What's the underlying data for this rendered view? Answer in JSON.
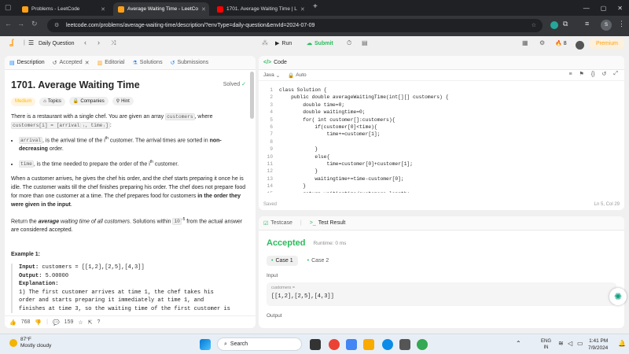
{
  "browser": {
    "tabs": [
      {
        "label": "Problems - LeetCode",
        "active": false
      },
      {
        "label": "Average Waiting Time - LeetCo",
        "active": true
      },
      {
        "label": "1701. Average Waiting Time | L",
        "active": false
      }
    ],
    "new_tab": "+",
    "url": "leetcode.com/problems/average-waiting-time/description/?envType=daily-question&envId=2024-07-09"
  },
  "header": {
    "daily_label": "Daily Question",
    "run_label": "Run",
    "submit_label": "Submit",
    "fire_count": "8",
    "premium_label": "Premium"
  },
  "left_tabs": [
    {
      "label": "Description"
    },
    {
      "label": "Accepted"
    },
    {
      "label": "Editorial"
    },
    {
      "label": "Solutions"
    },
    {
      "label": "Submissions"
    }
  ],
  "problem": {
    "title": "1701. Average Waiting Time",
    "solved": "Solved",
    "difficulty": "Medium",
    "topics": "Topics",
    "companies": "Companies",
    "hint": "Hint",
    "p1_a": "There is a restaurant with a single chef. You are given an array ",
    "p1_code": "customers",
    "p1_b": ", where",
    "p1_code2": "customers[i] = [arrival",
    "p1_c": " is the arrival time of the ",
    "b1_code": "arrival",
    "b1_a": ", is the arrival time of the ",
    "b1_i": "i",
    "b1_b": " customer. The arrival times are sorted in ",
    "b1_bold": "non-decreasing",
    "b1_c": " order.",
    "b2_code": "time",
    "b2_a": ", is the time needed to prepare the order of the ",
    "b2_b": " customer.",
    "p2": "When a customer arrives, he gives the chef his order, and the chef starts preparing it once he is idle. The customer waits till the chef finishes preparing his order. The chef does not prepare food for more than one customer at a time. The chef prepares food for customers ",
    "p2_bold": "in the order they were given in the input",
    "p3_a": "Return the ",
    "p3_i": "average",
    "p3_b": " waiting time of all customers",
    "p3_c": ". Solutions within ",
    "p3_code": "10",
    "p3_d": " from the actual answer are considered accepted.",
    "example_title": "Example 1:",
    "ex_input_label": "Input:",
    "ex_input": "customers = [[1,2],[2,5],[4,3]]",
    "ex_output_label": "Output:",
    "ex_output": "5.00000",
    "ex_expl_label": "Explanation:",
    "ex_expl": "1) The first customer arrives at time 1, the chef takes his\norder and starts preparing it immediately at time 1, and\nfinishes at time 3, so the waiting time of the first customer is"
  },
  "footer_left": {
    "likes": "768",
    "comments": "159"
  },
  "code_panel": {
    "title": "Code",
    "language": "Java",
    "mode": "Auto",
    "status": "Saved",
    "cursor": "Ln 5, Col 29",
    "lines": [
      "class Solution {",
      "    public double averageWaitingTime(int[][] customers) {",
      "        double time=0;",
      "        double waitingtime=0;",
      "        for( int customer[]:customers){",
      "            if(customer[0]<time){",
      "                time+=customer[1];",
      "",
      "            }",
      "            else{",
      "                time=customer[0]+customer[1];",
      "            }",
      "            waitingtime+=time-customer[0];",
      "        }",
      "        return waitingtime/customers.length;"
    ]
  },
  "test_panel": {
    "tab_testcase": "Testcase",
    "tab_result": "Test Result",
    "verdict": "Accepted",
    "runtime": "Runtime: 0 ms",
    "case1": "Case 1",
    "case2": "Case 2",
    "input_label": "Input",
    "var_name": "customers =",
    "var_value": "[[1,2],[2,5],[4,3]]",
    "output_label": "Output"
  },
  "taskbar": {
    "weather_temp": "87°F",
    "weather_desc": "Mostly cloudy",
    "search": "Search",
    "lang1": "ENG",
    "lang2": "IN",
    "time": "1:41 PM",
    "date": "7/9/2024"
  },
  "colors": {
    "accent_green": "#2cbb5d",
    "medium": "#ffb800",
    "premium": "#ffa116"
  }
}
